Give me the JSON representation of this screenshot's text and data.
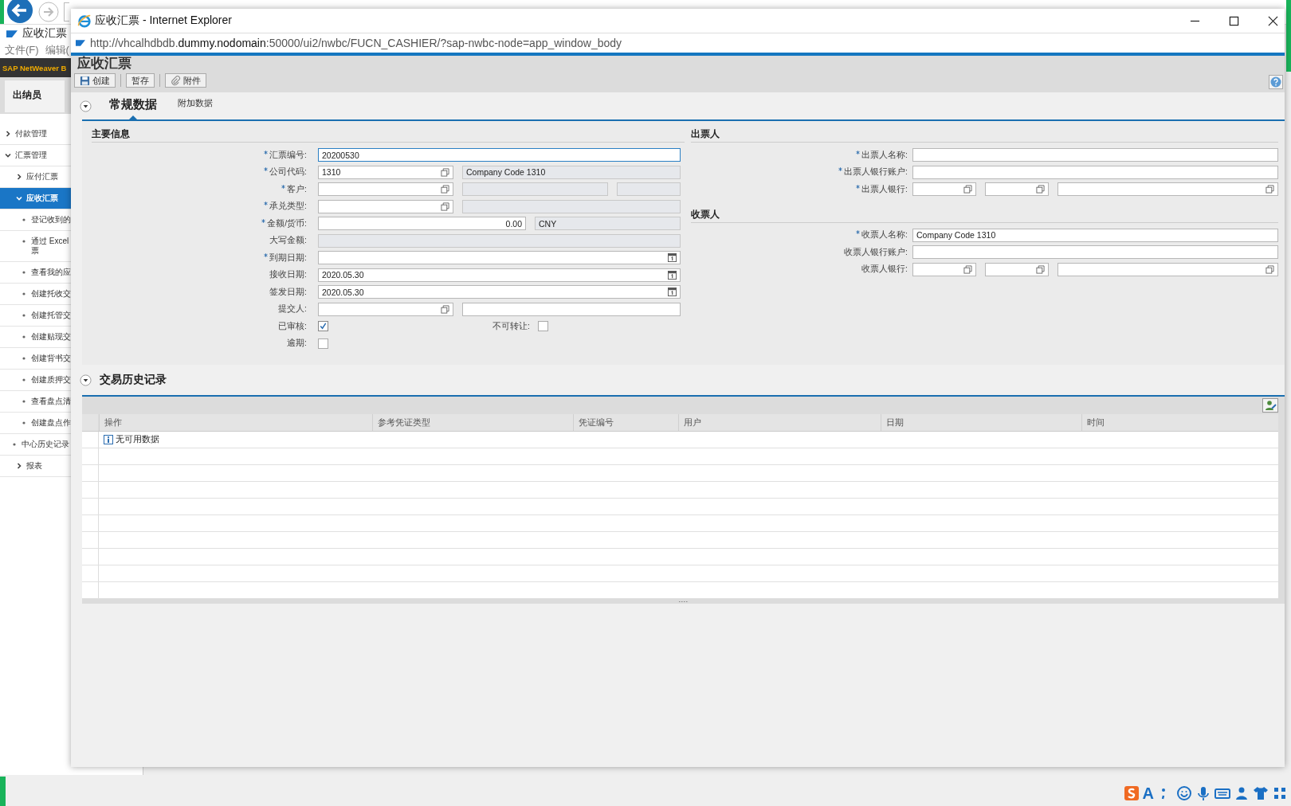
{
  "background": {
    "tab_title": "应收汇票",
    "menu": [
      "文件(F)",
      "编辑("
    ],
    "banner": "SAP NetWeaver B",
    "role_tab": "出纳员",
    "nav": [
      {
        "label": "付款管理",
        "kind": "folder",
        "expanded": false,
        "selected": false
      },
      {
        "label": "汇票管理",
        "kind": "folder",
        "expanded": true,
        "selected": false,
        "children": [
          {
            "label": "应付汇票",
            "kind": "folder",
            "expanded": false,
            "selected": false
          },
          {
            "label": "应收汇票",
            "kind": "folder",
            "expanded": true,
            "selected": true,
            "children": [
              {
                "label": "登记收到的",
                "kind": "leaf",
                "selected": false
              },
              {
                "label": "通过 Excel\n票",
                "kind": "leaf",
                "selected": false
              },
              {
                "label": "查看我的应",
                "kind": "leaf",
                "selected": false
              },
              {
                "label": "创建托收交",
                "kind": "leaf",
                "selected": false
              },
              {
                "label": "创建托管交",
                "kind": "leaf",
                "selected": false
              },
              {
                "label": "创建贴现交",
                "kind": "leaf",
                "selected": false
              },
              {
                "label": "创建背书交",
                "kind": "leaf",
                "selected": false
              },
              {
                "label": "创建质押交",
                "kind": "leaf",
                "selected": false
              },
              {
                "label": "查看盘点清",
                "kind": "leaf",
                "selected": false
              },
              {
                "label": "创建盘点作",
                "kind": "leaf",
                "selected": false
              }
            ]
          },
          {
            "label": "中心历史记录",
            "kind": "leaf",
            "selected": false
          },
          {
            "label": "报表",
            "kind": "folder",
            "expanded": false,
            "selected": false
          }
        ]
      }
    ],
    "ime_toolbar": [
      "A"
    ]
  },
  "window": {
    "title": "应收汇票 - Internet Explorer",
    "address": "http://vhcalhdbdb.**dummy.nodomain**:50000/ui2/nwbc/FUCN_CASHIER/?sap-nwbc-node=app_window_body"
  },
  "page": {
    "title": "应收汇票",
    "toolbar": [
      {
        "label": "创建",
        "kind": "save"
      },
      {
        "label": "暂存",
        "kind": "plain"
      },
      {
        "label": "附件",
        "kind": "attach"
      }
    ]
  },
  "form": {
    "tabs": [
      {
        "label": "常规数据",
        "selected": true
      },
      {
        "label": "附加数据",
        "selected": false
      }
    ],
    "left_sections": [
      {
        "title": "主要信息",
        "rows": [
          {
            "label": "汇票编号:",
            "required": true,
            "inputs": [
              {
                "kind": "text",
                "value": "20200530",
                "focused": true
              }
            ]
          },
          {
            "label": "公司代码:",
            "required": true,
            "inputs": [
              {
                "kind": "lookup",
                "value": "1310"
              },
              {
                "kind": "readonly",
                "value": "Company Code 1310"
              }
            ]
          },
          {
            "label": "客户:",
            "required": true,
            "inputs": [
              {
                "kind": "lookup"
              },
              {
                "kind": "readonly"
              },
              {
                "kind": "readonly"
              }
            ]
          },
          {
            "label": "承兑类型:",
            "required": true,
            "inputs": [
              {
                "kind": "lookup"
              },
              {
                "kind": "readonly"
              }
            ]
          },
          {
            "label": "金额/货币:",
            "required": true,
            "inputs": [
              {
                "kind": "number",
                "value": "0.00"
              },
              {
                "kind": "readonly",
                "value": "CNY"
              }
            ]
          },
          {
            "label": "大写金额:",
            "required": false,
            "inputs": [
              {
                "kind": "readonly"
              }
            ]
          },
          {
            "label": "到期日期:",
            "required": true,
            "inputs": [
              {
                "kind": "date"
              }
            ]
          },
          {
            "label": "接收日期:",
            "required": false,
            "inputs": [
              {
                "kind": "date",
                "value": "2020.05.30"
              }
            ]
          },
          {
            "label": "签发日期:",
            "required": false,
            "inputs": [
              {
                "kind": "date",
                "value": "2020.05.30"
              }
            ]
          },
          {
            "label": "提交人:",
            "required": false,
            "inputs": [
              {
                "kind": "lookup"
              },
              {
                "kind": "text"
              }
            ]
          },
          {
            "kind": "checks",
            "items": [
              {
                "label": "已审核:",
                "checked": true
              },
              {
                "label": "不可转让:",
                "checked": false
              }
            ]
          },
          {
            "kind": "checks",
            "items": [
              {
                "label": "逾期:",
                "checked": false
              }
            ]
          }
        ]
      }
    ],
    "right_sections": [
      {
        "title": "出票人",
        "rows": [
          {
            "label": "出票人名称:",
            "required": true,
            "inputs": [
              {
                "kind": "text"
              }
            ]
          },
          {
            "label": "出票人银行账户:",
            "required": true,
            "inputs": [
              {
                "kind": "text"
              }
            ]
          },
          {
            "label": "出票人银行:",
            "required": true,
            "inputs": [
              {
                "kind": "lookup"
              },
              {
                "kind": "lookup"
              },
              {
                "kind": "lookup"
              }
            ]
          }
        ]
      },
      {
        "title": "收票人",
        "rows": [
          {
            "label": "收票人名称:",
            "required": true,
            "inputs": [
              {
                "kind": "text",
                "value": "Company Code 1310"
              }
            ]
          },
          {
            "label": "收票人银行账户:",
            "required": false,
            "inputs": [
              {
                "kind": "text"
              }
            ]
          },
          {
            "label": "收票人银行:",
            "required": false,
            "inputs": [
              {
                "kind": "lookup"
              },
              {
                "kind": "lookup"
              },
              {
                "kind": "lookup"
              }
            ]
          }
        ]
      }
    ]
  },
  "history": {
    "title": "交易历史记录",
    "columns": [
      "操作",
      "参考凭证类型",
      "凭证编号",
      "用户",
      "日期",
      "时间"
    ],
    "message": "无可用数据"
  }
}
